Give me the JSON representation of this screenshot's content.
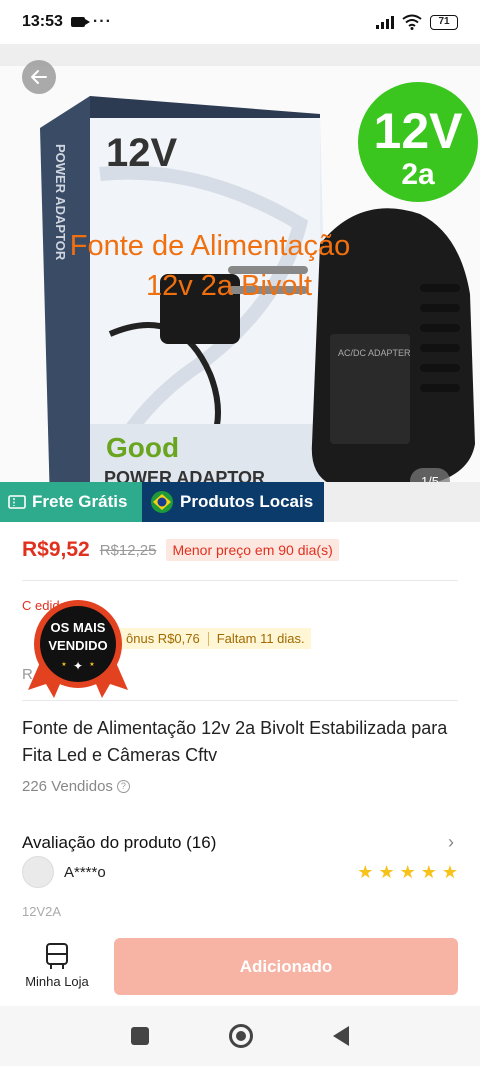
{
  "status_bar": {
    "time": "13:53",
    "battery": "71",
    "more": "···"
  },
  "gallery": {
    "counter": "1/5",
    "promo_line1": "Fonte de Alimentação",
    "promo_line2": "12v 2a  Bivolt",
    "box_voltage": "12V",
    "box_side_text": "POWER ADAPTOR",
    "box_good": "Good",
    "box_bottom": "POWER ADAPTOR",
    "badge_volt": "12V",
    "badge_amp": "2a",
    "adapter_label": "AC/DC ADAPTER"
  },
  "tags": {
    "frete": "Frete Grátis",
    "locais": "Produtos Locais"
  },
  "price": {
    "current": "R$9,52",
    "old": "R$12,25",
    "lowest": "Menor preço em 90 dia(s)"
  },
  "coupon": {
    "line": "C          edido",
    "bonus": "ônus R$0,76",
    "remaining": "Faltam 11 dias.",
    "faded": "R"
  },
  "badge": {
    "line1": "OS MAIS",
    "line2": "VENDIDO"
  },
  "product": {
    "title": "Fonte de Alimentação 12v 2a Bivolt Estabilizada para Fita Led e Câmeras Cftv",
    "sold": "226 Vendidos"
  },
  "reviews": {
    "heading": "Avaliação do produto (16)",
    "reviewer": "A****o",
    "stars": 5,
    "variant": "12V2A"
  },
  "actions": {
    "shop_label": "Minha Loja",
    "add_label": "Adicionado"
  },
  "colors": {
    "price_red": "#e0311e",
    "frete_green": "#2eaa8c",
    "locais_navy": "#0b3b6a",
    "button_salmon": "#f7b3a4",
    "star_yellow": "#f7c21b",
    "promo_orange": "#f07010"
  }
}
